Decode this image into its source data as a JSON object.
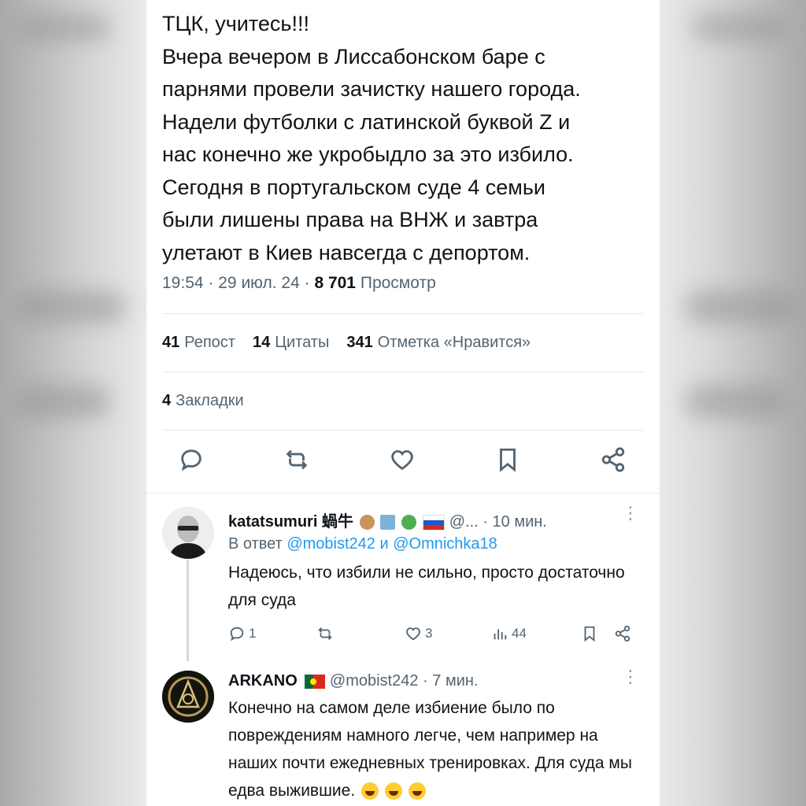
{
  "tweet": {
    "text": "ТЦК, учитесь!!!\nВчера вечером в Лиссабонском баре с\nпарнями провели зачистку нашего города.\nНадели футболки с латинской буквой Z и\nнас конечно же укробыдло за это избило.\nСегодня в португальском суде  4 семьи\nбыли лишены права на ВНЖ и завтра\nулетают в Киев навсегда с депортом.",
    "time": "19:54",
    "date": "29 июл. 24",
    "separator": "·",
    "views_count": "8 701",
    "views_label": "Просмотр"
  },
  "stats": {
    "reposts_count": "41",
    "reposts_label": "Репост",
    "quotes_count": "14",
    "quotes_label": "Цитаты",
    "likes_count": "341",
    "likes_label": "Отметка «Нравится»",
    "bookmarks_count": "4",
    "bookmarks_label": "Закладки"
  },
  "actions": [
    "reply-icon",
    "repost-icon",
    "like-icon",
    "bookmark-icon",
    "share-icon"
  ],
  "replies": [
    {
      "name": "katatsumuri 蝸牛",
      "handle": "@...",
      "time": "· 10 мин.",
      "reply_to_prefix": "В ответ",
      "reply_to_user1": "@mobist242",
      "reply_to_join": "и",
      "reply_to_user2": "@Omnichka18",
      "text": "Надеюсь, что избили не сильно, просто достаточно для суда",
      "reply_count": "1",
      "repost_count": "",
      "like_count": "3",
      "views_count": "44"
    },
    {
      "name": "ARKANO",
      "handle": "@mobist242",
      "time": "· 7 мин.",
      "text": "Конечно на самом деле избиение было по повреждениям намного легче, чем например на наших почти ежедневных тренировках. Для суда мы едва выжившие."
    }
  ],
  "colors": {
    "text": "#0f1419",
    "muted": "#536471",
    "link": "#1d9bf0",
    "divider": "#e6e9eb"
  }
}
